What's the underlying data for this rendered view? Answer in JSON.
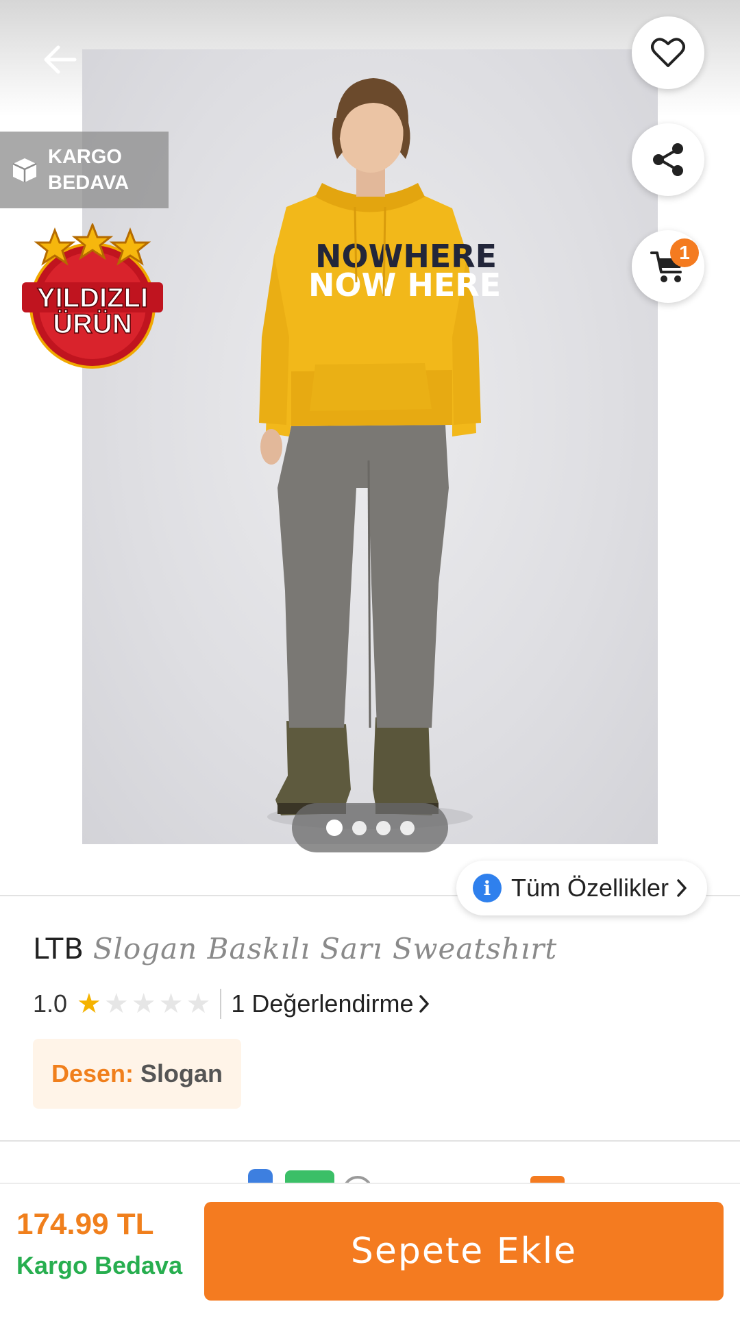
{
  "header": {
    "back_icon": "arrow-left-icon",
    "favorite_icon": "heart-outline-icon",
    "share_icon": "share-icon",
    "cart_icon": "cart-icon",
    "cart_count": "1"
  },
  "gallery": {
    "kargo_badge_line1": "KARGO",
    "kargo_badge_line2": "BEDAVA",
    "star_badge_line1": "YILDIZLI",
    "star_badge_line2": "ÜRÜN",
    "shirt_print_line1": "NOWHERE",
    "shirt_print_line2": "NOW HERE",
    "page_count": 4,
    "active_page": 1,
    "features_label": "Tüm Özellikler",
    "features_info_glyph": "i"
  },
  "product": {
    "brand": "LTB",
    "name": "Slogan Baskılı Sarı Sweatshırt",
    "rating": "1.0",
    "rating_stars_filled": 1,
    "rating_stars_total": 5,
    "reviews_label": "1 Değerlendirme",
    "pattern_key": "Desen:",
    "pattern_value": "Slogan"
  },
  "bottom_bar": {
    "price": "174.99 TL",
    "shipping": "Kargo Bedava",
    "add_to_cart": "Sepete Ekle"
  },
  "colors": {
    "accent_orange": "#f47b20",
    "shipping_green": "#27ae4f",
    "star_gold": "#f5b301",
    "info_blue": "#2f80ed"
  }
}
